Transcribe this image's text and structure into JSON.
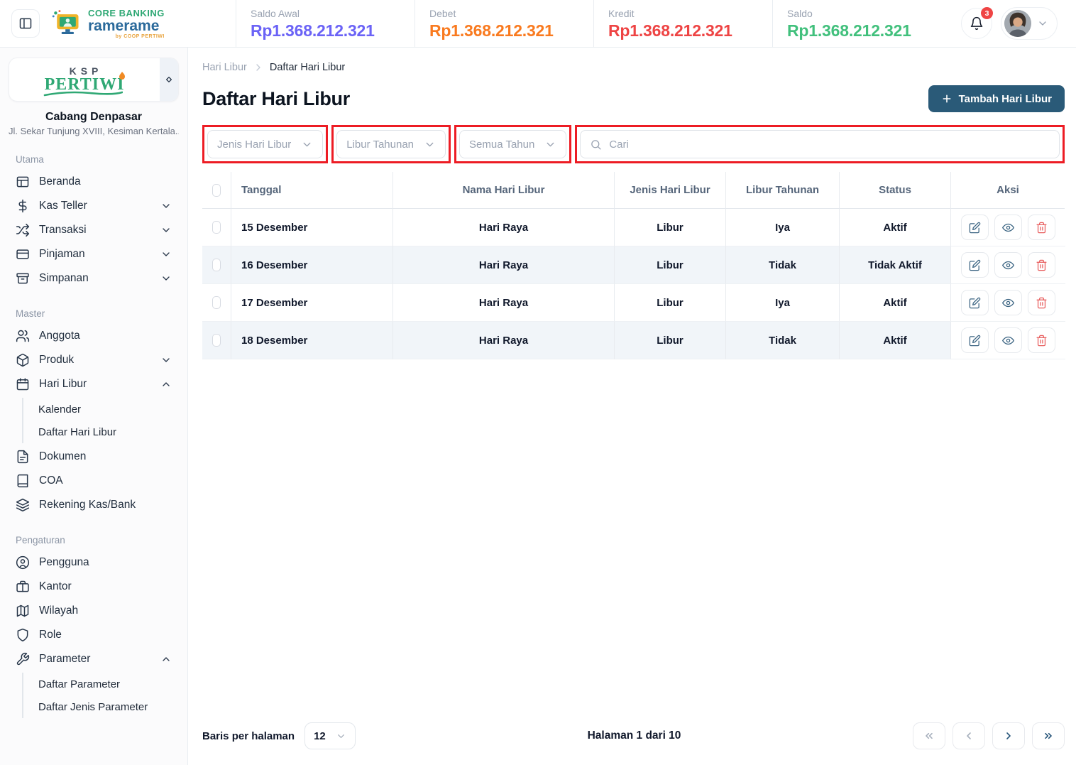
{
  "header": {
    "logo": {
      "title": "CORE BANKING",
      "brand": "ramerame",
      "byline": "by COOP PERTIWI"
    },
    "stats": [
      {
        "label": "Saldo Awal",
        "value": "Rp1.368.212.321",
        "color": "#6b63f6"
      },
      {
        "label": "Debet",
        "value": "Rp1.368.212.321",
        "color": "#f97a1f"
      },
      {
        "label": "Kredit",
        "value": "Rp1.368.212.321",
        "color": "#ee4444"
      },
      {
        "label": "Saldo",
        "value": "Rp1.368.212.321",
        "color": "#41c07c"
      }
    ],
    "notification_count": "3"
  },
  "sidebar": {
    "branch_logo": {
      "top": "KSP",
      "main": "PERTIWI"
    },
    "branch_name": "Cabang Denpasar",
    "branch_address": "Jl. Sekar Tunjung XVIII, Kesiman Kertala...",
    "sections": [
      {
        "label": "Utama",
        "items": [
          {
            "label": "Beranda"
          },
          {
            "label": "Kas Teller"
          },
          {
            "label": "Transaksi"
          },
          {
            "label": "Pinjaman"
          },
          {
            "label": "Simpanan"
          }
        ]
      },
      {
        "label": "Master",
        "items": [
          {
            "label": "Anggota"
          },
          {
            "label": "Produk"
          },
          {
            "label": "Hari Libur",
            "children": [
              "Kalender",
              "Daftar Hari Libur"
            ]
          },
          {
            "label": "Dokumen"
          },
          {
            "label": "COA"
          },
          {
            "label": "Rekening Kas/Bank"
          }
        ]
      },
      {
        "label": "Pengaturan",
        "items": [
          {
            "label": "Pengguna"
          },
          {
            "label": "Kantor"
          },
          {
            "label": "Wilayah"
          },
          {
            "label": "Role"
          },
          {
            "label": "Parameter",
            "children": [
              "Daftar Parameter",
              "Daftar Jenis Parameter"
            ]
          }
        ]
      }
    ]
  },
  "main": {
    "breadcrumb": [
      "Hari Libur",
      "Daftar Hari Libur"
    ],
    "title": "Daftar Hari Libur",
    "add_button": "Tambah Hari Libur",
    "filters": {
      "jenis": "Jenis Hari Libur",
      "tahunan": "Libur Tahunan",
      "tahun": "Semua Tahun",
      "search_placeholder": "Cari"
    },
    "table": {
      "headers": [
        "Tanggal",
        "Nama Hari Libur",
        "Jenis Hari Libur",
        "Libur Tahunan",
        "Status",
        "Aksi"
      ],
      "rows": [
        {
          "tanggal": "15 Desember",
          "nama": "Hari Raya",
          "jenis": "Libur",
          "tahunan": "Iya",
          "status": "Aktif"
        },
        {
          "tanggal": "16 Desember",
          "nama": "Hari Raya",
          "jenis": "Libur",
          "tahunan": "Tidak",
          "status": "Tidak Aktif"
        },
        {
          "tanggal": "17 Desember",
          "nama": "Hari Raya",
          "jenis": "Libur",
          "tahunan": "Iya",
          "status": "Aktif"
        },
        {
          "tanggal": "18 Desember",
          "nama": "Hari Raya",
          "jenis": "Libur",
          "tahunan": "Tidak",
          "status": "Aktif"
        }
      ]
    },
    "pagination": {
      "rows_label": "Baris per halaman",
      "rows_value": "12",
      "page_info": "Halaman 1 dari 10"
    }
  }
}
